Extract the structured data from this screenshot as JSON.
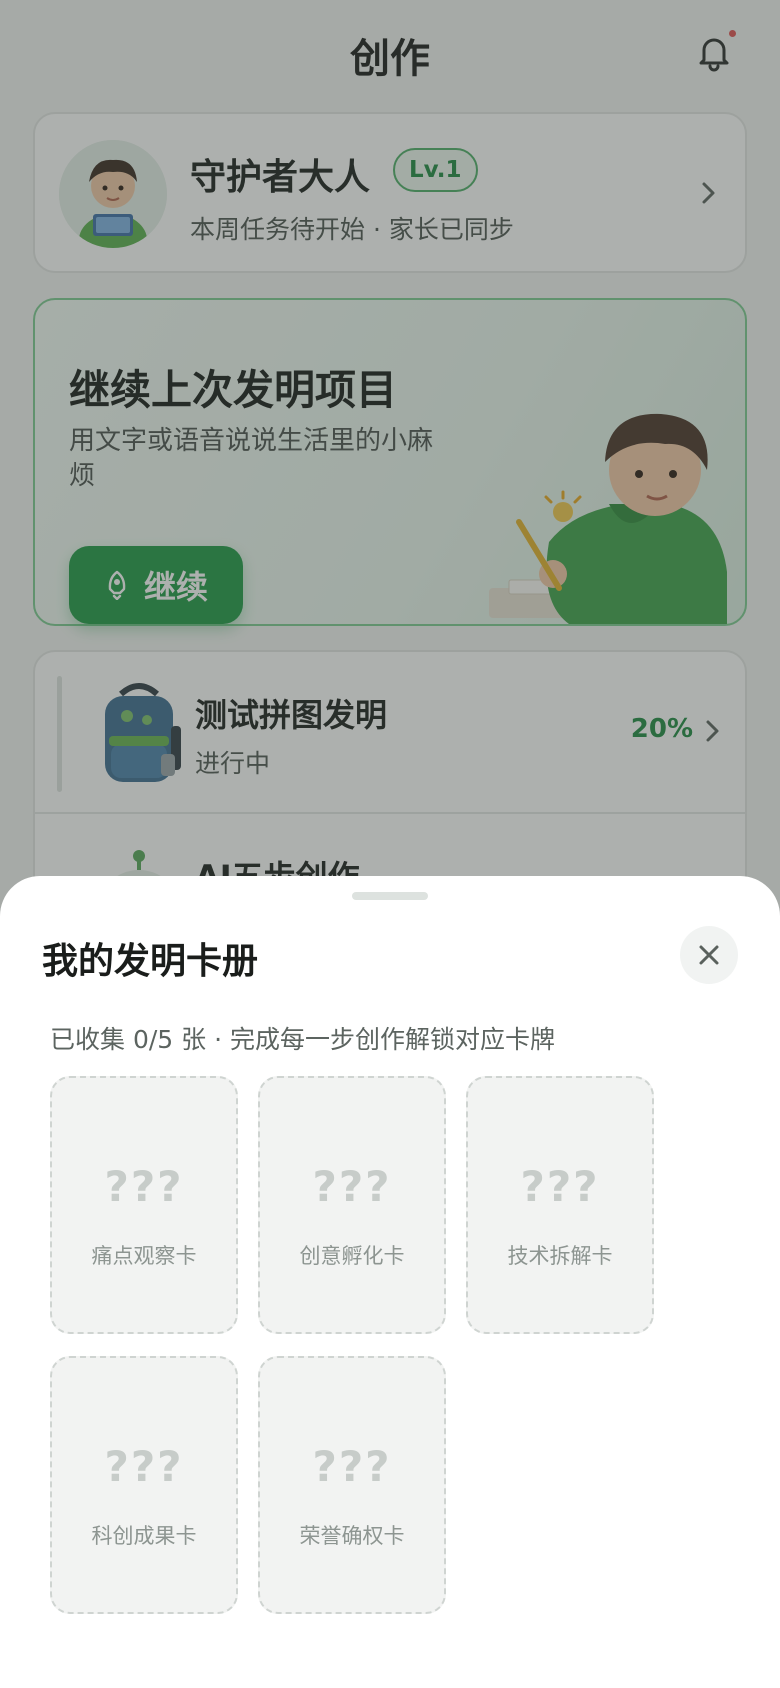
{
  "header": {
    "title": "创作",
    "notification_icon": "bell-icon"
  },
  "profile": {
    "name": "守护者大人",
    "level": "Lv.1",
    "status": "本周任务待开始 · 家长已同步"
  },
  "hero": {
    "title": "继续上次发明项目",
    "subtitle": "用文字或语音说说生活里的小麻烦",
    "button_label": "继续",
    "button_icon": "rocket-icon"
  },
  "projects": [
    {
      "title": "测试拼图发明",
      "status": "进行中",
      "progress": "20%"
    },
    {
      "title": "AI五步创作",
      "status": "",
      "progress": ""
    }
  ],
  "sheet": {
    "title": "我的发明卡册",
    "subtitle": "已收集 0/5 张 · 完成每一步创作解锁对应卡牌",
    "cards": [
      {
        "placeholder": "???",
        "label": "痛点观察卡"
      },
      {
        "placeholder": "???",
        "label": "创意孵化卡"
      },
      {
        "placeholder": "???",
        "label": "技术拆解卡"
      },
      {
        "placeholder": "???",
        "label": "科创成果卡"
      },
      {
        "placeholder": "???",
        "label": "荣誉确权卡"
      }
    ]
  },
  "colors": {
    "accent": "#1f9a46",
    "accent_text": "#1f8a43",
    "overlay": "#3c423e"
  }
}
